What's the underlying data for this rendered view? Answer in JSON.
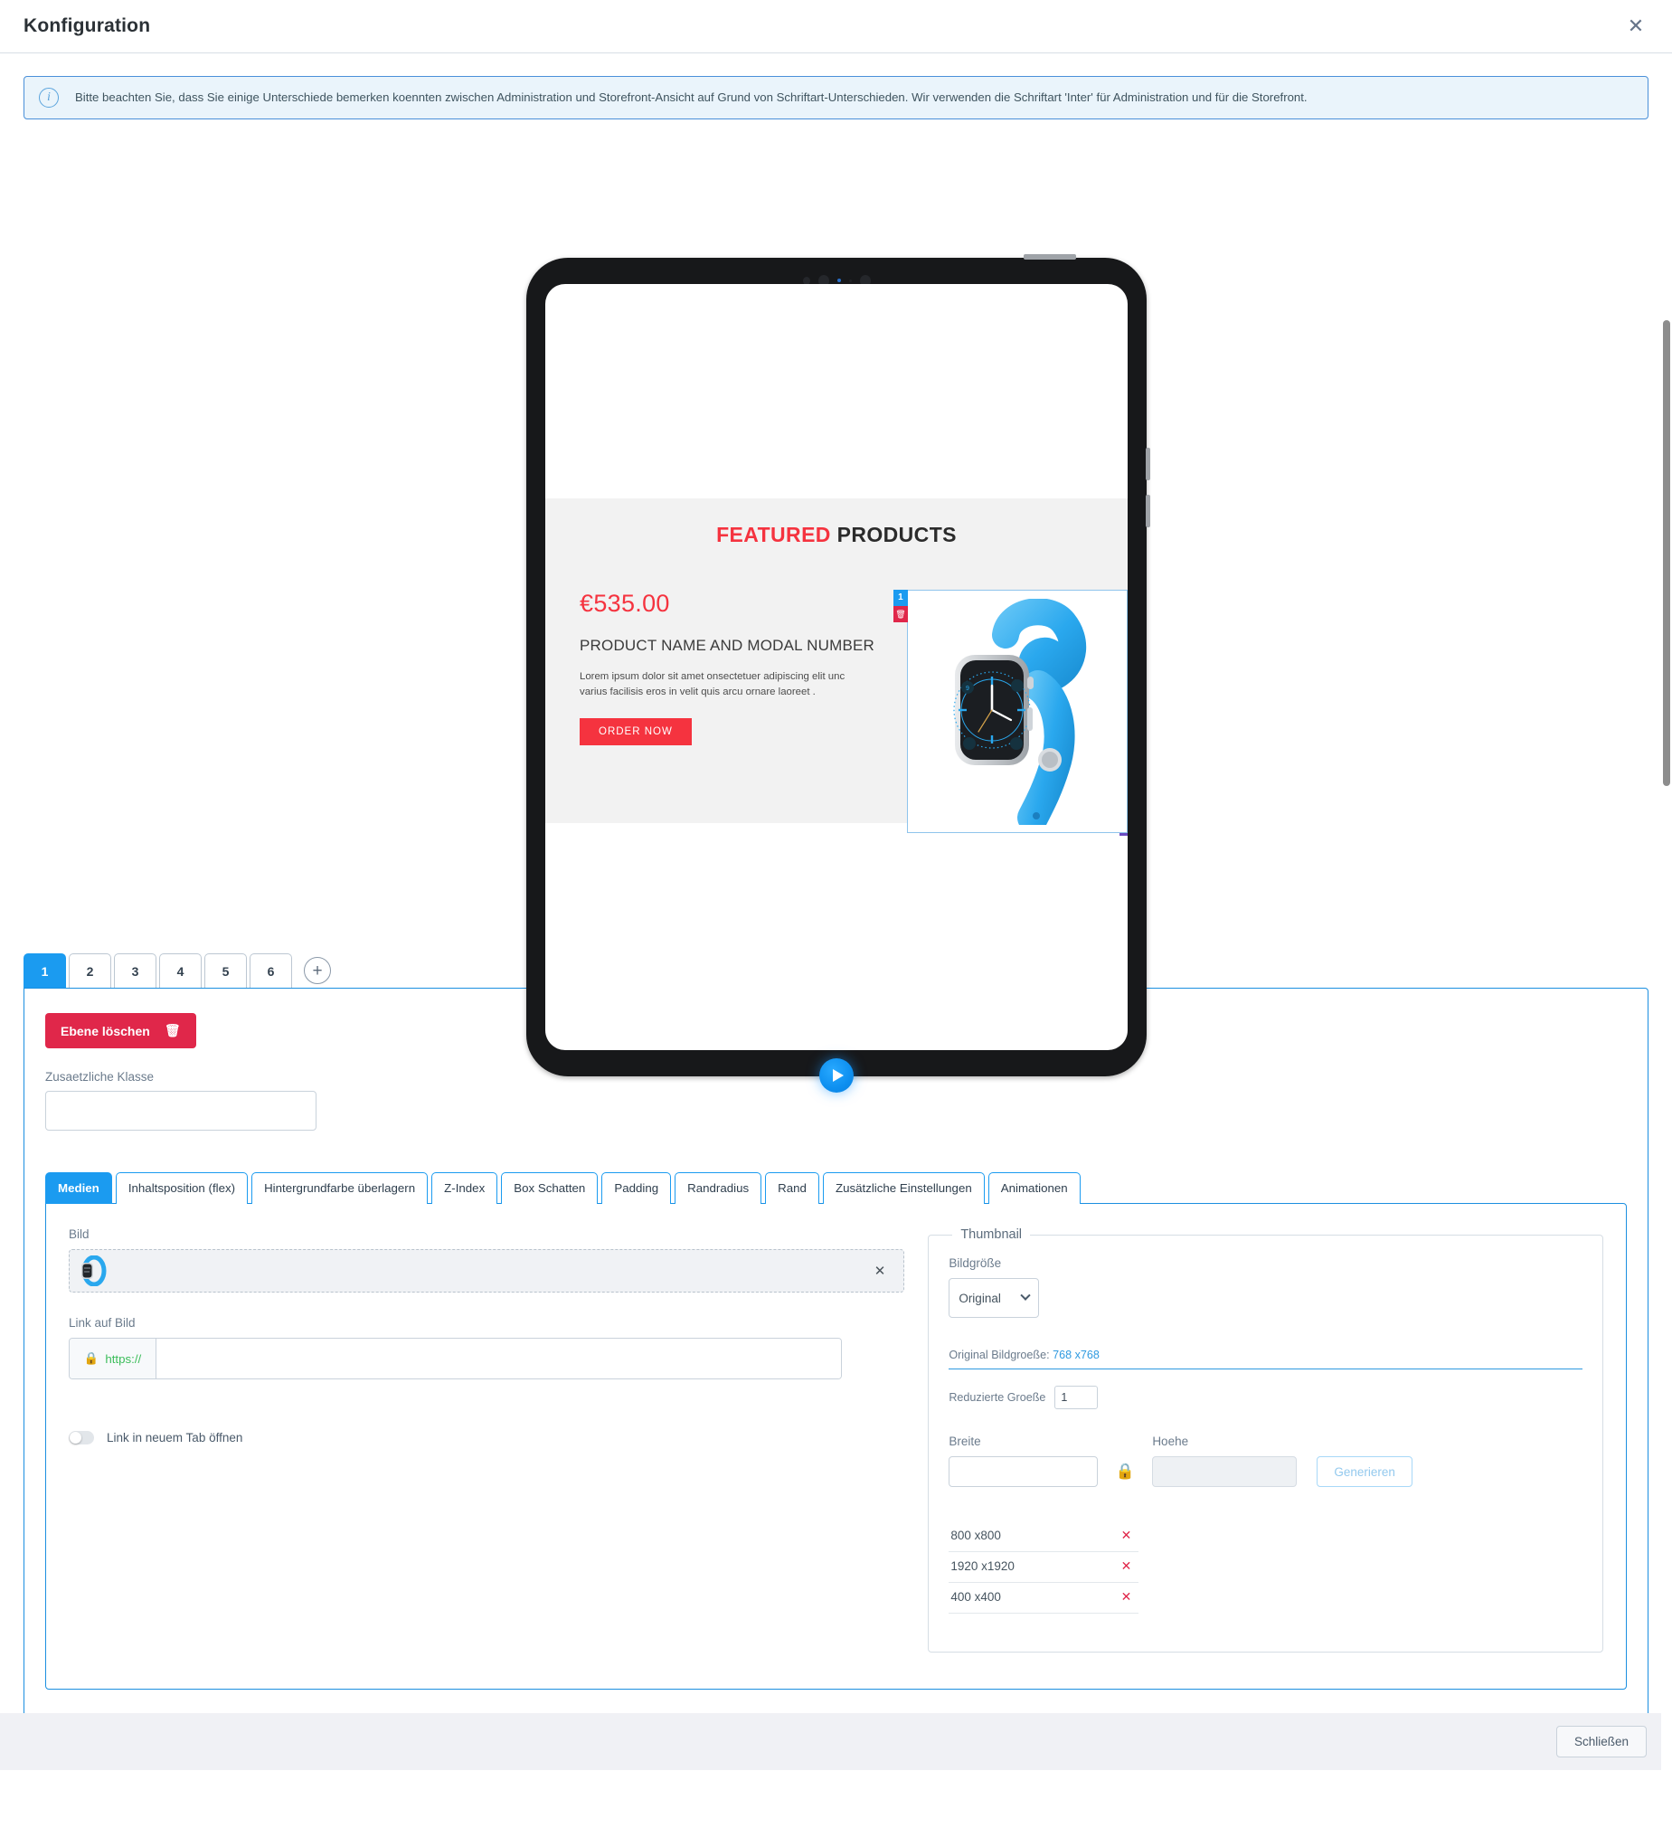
{
  "header": {
    "title": "Konfiguration",
    "close_icon": "close-icon"
  },
  "alert": {
    "icon": "info-icon",
    "text": "Bitte beachten Sie, dass Sie einige Unterschiede bemerken koennten zwischen Administration und Storefront-Ansicht auf Grund von Schriftart-Unterschieden. Wir verwenden die Schriftart 'Inter' für Administration und für die Storefront."
  },
  "preview": {
    "device": "tablet",
    "play_button_icon": "play-icon",
    "storefront": {
      "heading_highlight": "FEATURED",
      "heading_rest": "PRODUCTS",
      "price": "€535.00",
      "product_name": "PRODUCT NAME AND MODAL NUMBER",
      "description": "Lorem ipsum dolor sit amet onsectetuer adipiscing elit unc varius facilisis eros in velit quis arcu ornare laoreet .",
      "cta_label": "ORDER NOW",
      "layer_badge_number": "1",
      "layer_badge_delete_icon": "trash-icon",
      "product_image_alt": "blue-smartwatch-image"
    }
  },
  "layer_tabs": {
    "items": [
      "1",
      "2",
      "3",
      "4",
      "5",
      "6"
    ],
    "active_index": 0,
    "add_label": "+"
  },
  "layer_panel": {
    "delete_button": {
      "label": "Ebene löschen",
      "icon": "trash-icon",
      "color": "#e0274a"
    },
    "extra_class": {
      "label": "Zusaetzliche Klasse",
      "value": "",
      "placeholder": ""
    }
  },
  "prop_tabs": {
    "items": [
      "Medien",
      "Inhaltsposition (flex)",
      "Hintergrundfarbe überlagern",
      "Z-Index",
      "Box Schatten",
      "Padding",
      "Randradius",
      "Rand",
      "Zusätzliche Einstellungen",
      "Animationen"
    ],
    "active_index": 0
  },
  "media_tab": {
    "image": {
      "label": "Bild",
      "thumb_alt": "blue-smartwatch-thumbnail",
      "clear_icon": "close-icon"
    },
    "link": {
      "label": "Link auf Bild",
      "prefix_icon": "lock-icon",
      "prefix_text": "https://",
      "value": "",
      "placeholder": ""
    },
    "new_tab_switch": {
      "label": "Link in neuem Tab öffnen",
      "on": false
    }
  },
  "thumbnail": {
    "legend": "Thumbnail",
    "image_size": {
      "label": "Bildgröße",
      "selected": "Original",
      "options": [
        "Original"
      ]
    },
    "original_size": {
      "label": "Original Bildgroeße:",
      "value": "768 x768"
    },
    "reduced_size": {
      "label": "Reduzierte Groeße",
      "value": "1"
    },
    "width": {
      "label": "Breite",
      "value": "",
      "placeholder": ""
    },
    "height": {
      "label": "Hoehe",
      "value": "",
      "placeholder": ""
    },
    "lock_icon": "lock-icon",
    "generate_button": "Generieren",
    "sizes": [
      {
        "label": "800 x800",
        "remove_icon": "close-icon"
      },
      {
        "label": "1920 x1920",
        "remove_icon": "close-icon"
      },
      {
        "label": "400 x400",
        "remove_icon": "close-icon"
      }
    ]
  },
  "footer": {
    "close_label": "Schließen"
  },
  "colors": {
    "accent": "#1b9bf0",
    "danger": "#e0274a",
    "storefront_accent": "#f5333f",
    "link": "#2f9ae0"
  }
}
